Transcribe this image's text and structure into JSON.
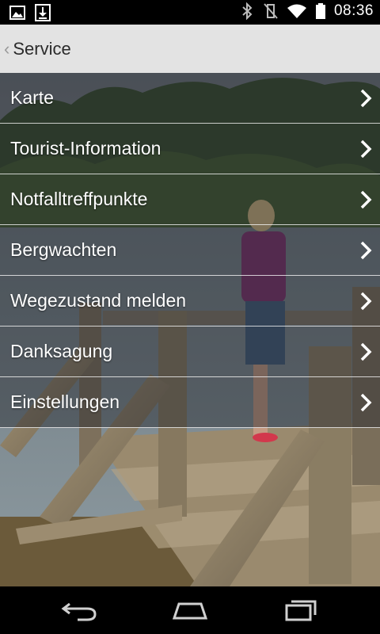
{
  "status_bar": {
    "time": "08:36",
    "left_icons": [
      "image-icon",
      "download-icon"
    ],
    "right_icons": [
      "bluetooth-icon",
      "vibrate-off-icon",
      "wifi-icon",
      "battery-icon"
    ]
  },
  "action_bar": {
    "back_icon": "chevron-left-icon",
    "title": "Service"
  },
  "menu": {
    "items": [
      {
        "label": "Karte"
      },
      {
        "label": "Tourist-Information"
      },
      {
        "label": "Notfalltreffpunkte"
      },
      {
        "label": "Bergwachten"
      },
      {
        "label": "Wegezustand melden"
      },
      {
        "label": "Danksagung"
      },
      {
        "label": "Einstellungen"
      }
    ]
  },
  "nav_bar": {
    "icons": [
      "back-icon",
      "home-icon",
      "recents-icon"
    ]
  },
  "colors": {
    "action_bar": "#e3e3e3",
    "menu_overlay": "#23262d",
    "text": "#ffffff"
  }
}
